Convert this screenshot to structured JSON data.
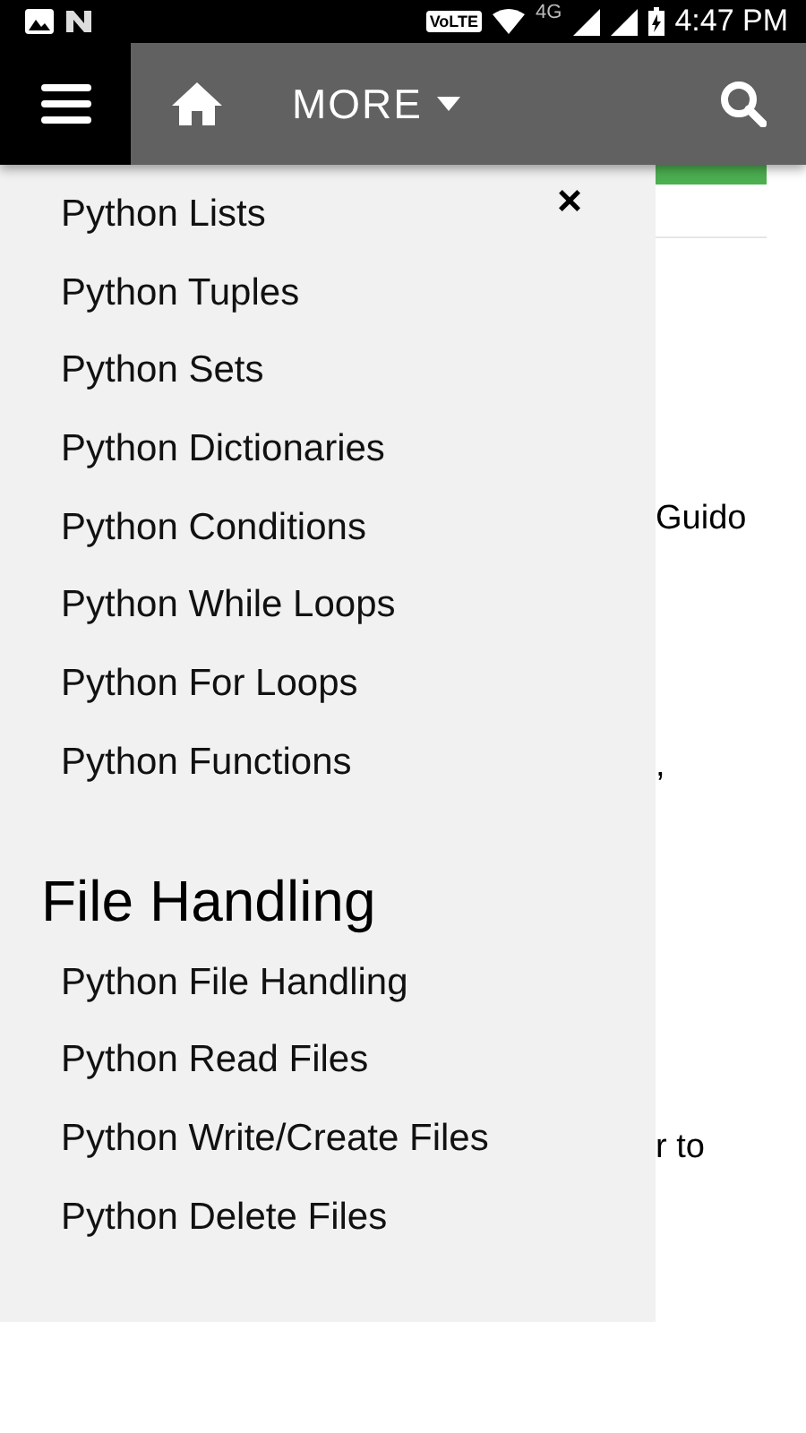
{
  "status_bar": {
    "volte": "VoLTE",
    "network": "4G",
    "time": "4:47 PM"
  },
  "nav": {
    "more": "MORE"
  },
  "page_fragments": [
    "Guido",
    ",",
    "r to"
  ],
  "menu": {
    "sections": [
      {
        "items": [
          "Python Lists",
          "Python Tuples",
          "Python Sets",
          "Python Dictionaries",
          "Python Conditions",
          "Python While Loops",
          "Python For Loops",
          "Python Functions"
        ]
      },
      {
        "heading": "File Handling",
        "items": [
          "Python File Handling",
          "Python Read Files",
          "Python Write/Create Files",
          "Python Delete Files"
        ]
      }
    ],
    "close": "×"
  }
}
